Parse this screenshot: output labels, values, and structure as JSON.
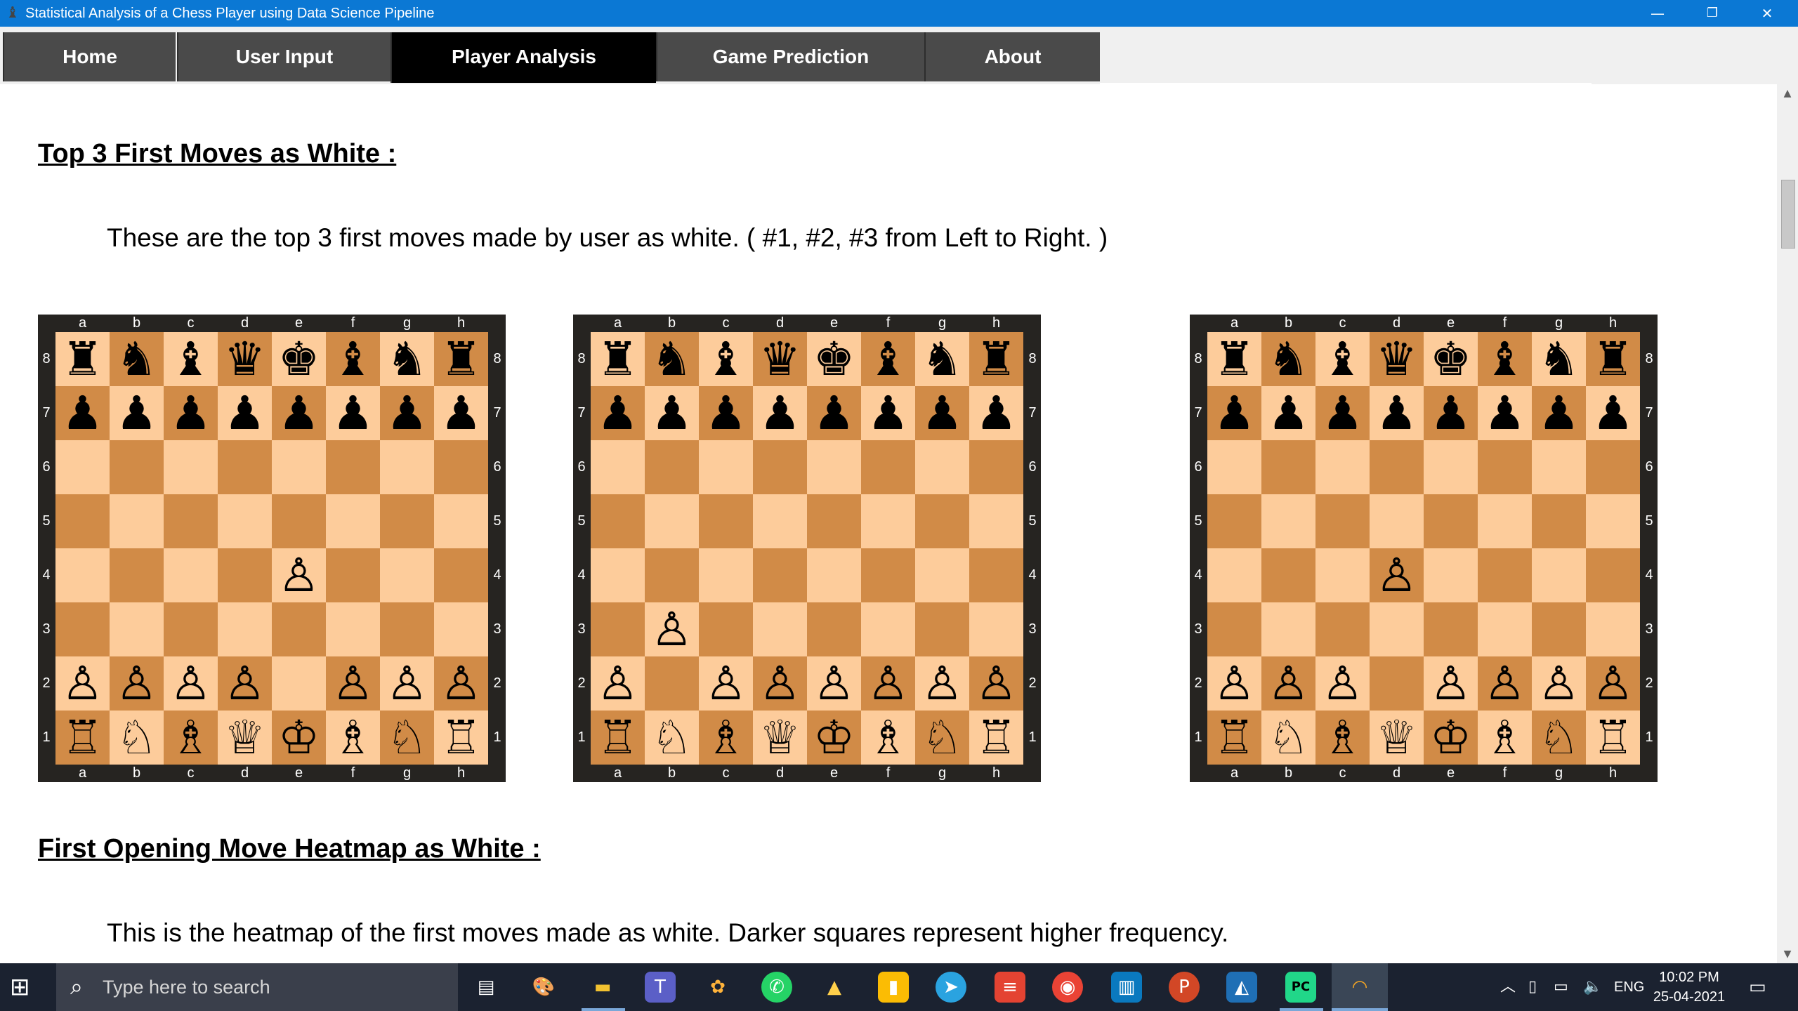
{
  "window": {
    "title": "Statistical Analysis of a Chess Player using Data Science Pipeline",
    "controls": {
      "minimize": "—",
      "restore": "❐",
      "close": "✕"
    }
  },
  "tabs": [
    {
      "label": "Home",
      "active": false
    },
    {
      "label": "User Input",
      "active": false
    },
    {
      "label": "Player  Analysis",
      "active": true
    },
    {
      "label": "Game Prediction",
      "active": false
    },
    {
      "label": "About",
      "active": false
    }
  ],
  "section1": {
    "heading": "Top 3 First Moves as White :",
    "description": "These are the top 3 first moves made by user as white. ( #1, #2, #3 from Left to Right. )"
  },
  "boards": {
    "files": [
      "a",
      "b",
      "c",
      "d",
      "e",
      "f",
      "g",
      "h"
    ],
    "ranks": [
      "8",
      "7",
      "6",
      "5",
      "4",
      "3",
      "2",
      "1"
    ],
    "light_color": "#fdcc9b",
    "dark_color": "#d18b47",
    "positions": [
      {
        "move": "e2e4",
        "fen_rows": [
          "rnbqkbnr",
          "pppppppp",
          "........",
          "........",
          "....P...",
          "........",
          "PPPP.PPP",
          "RNBQKBNR"
        ]
      },
      {
        "move": "b2b3",
        "fen_rows": [
          "rnbqkbnr",
          "pppppppp",
          "........",
          "........",
          "........",
          ".P......",
          "P.PPPPPP",
          "RNBQKBNR"
        ]
      },
      {
        "move": "d2d4",
        "fen_rows": [
          "rnbqkbnr",
          "pppppppp",
          "........",
          "........",
          "...P....",
          "........",
          "PPP.PPPP",
          "RNBQKBNR"
        ]
      }
    ]
  },
  "section2": {
    "heading": "First Opening Move Heatmap as White :",
    "description": "This is the heatmap of the first moves made as white. Darker squares represent higher frequency."
  },
  "taskbar": {
    "search_placeholder": "Type here to search",
    "language": "ENG",
    "time": "10:02 PM",
    "date": "25-04-2021",
    "pinned_icons": [
      "task-view-icon",
      "paint-icon",
      "file-explorer-icon",
      "teams-icon",
      "photos-icon",
      "whatsapp-icon",
      "google-drive-icon",
      "keep-notes-icon",
      "telegram-icon",
      "todoist-icon",
      "chrome-icon",
      "trello-icon",
      "powerpoint-icon",
      "photos-viewer-icon",
      "pycharm-icon",
      "python-app-icon"
    ]
  }
}
